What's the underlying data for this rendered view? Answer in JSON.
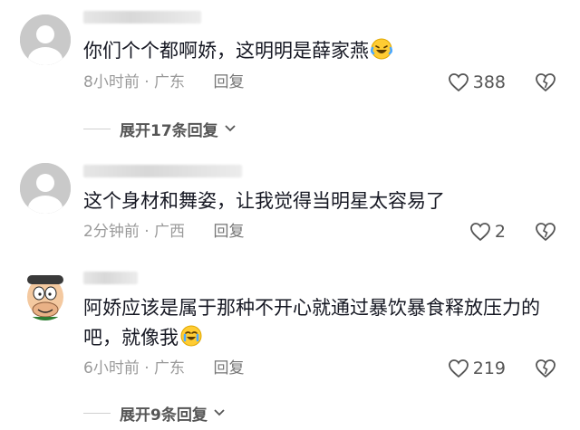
{
  "comments": [
    {
      "text": "你们个个都啊娇，这明明是薛家燕",
      "emoji": "laughing-crying-emoji",
      "time": "8小时前",
      "location": "广东",
      "reply_label": "回复",
      "likes": "388",
      "expand_label": "展开17条回复"
    },
    {
      "text": "这个身材和舞姿，让我觉得当明星太容易了",
      "time": "2分钟前",
      "location": "广西",
      "reply_label": "回复",
      "likes": "2"
    },
    {
      "text": "阿娇应该是属于那种不开心就通过暴饮暴食释放压力的吧，就像我",
      "emoji": "crying-laughing-emoji",
      "time": "6小时前",
      "location": "广东",
      "reply_label": "回复",
      "likes": "219",
      "expand_label": "展开9条回复"
    }
  ],
  "colors": {
    "meta": "#9a9a9a",
    "text": "#161823",
    "avatar_placeholder": "#c9c9c9"
  },
  "separator": "·"
}
